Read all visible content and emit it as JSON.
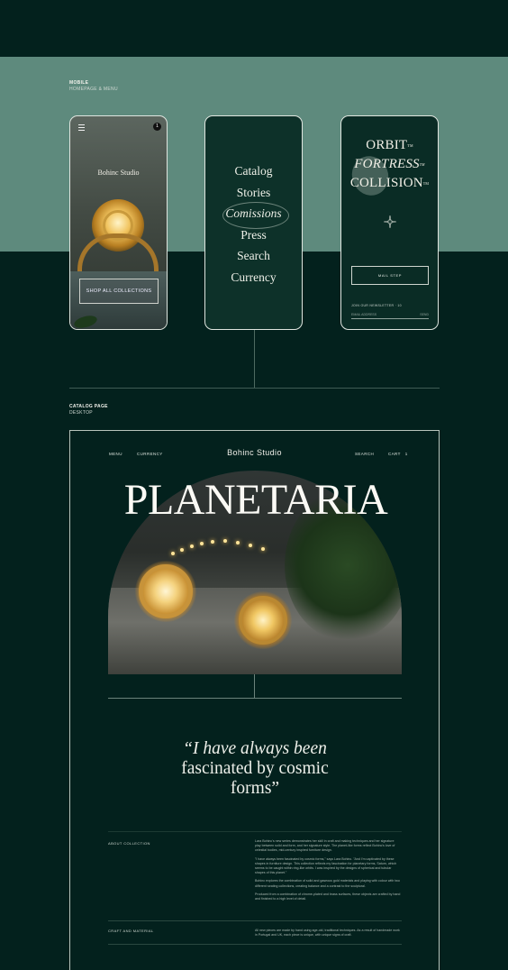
{
  "mobile_section": {
    "title": "MOBILE",
    "subtitle": "HOMEPAGE & MENU"
  },
  "phone1": {
    "cart_count": "1",
    "brand": "Bohinc Studio",
    "cta": "SHOP ALL COLLECTIONS"
  },
  "phone2": {
    "menu_items": [
      "Catalog",
      "Stories",
      "Comissions",
      "Press",
      "Search",
      "Currency"
    ]
  },
  "phone3": {
    "line1": "ORBIT",
    "line2": "FORTRESS",
    "line3": "COLLISION",
    "tm": "TM",
    "cta": "MAIL STEP",
    "newsletter_label": "JOIN OUR NEWSLETTER · 10",
    "email_placeholder": "EMAIL ADDRESS",
    "submit": "SEND"
  },
  "catalog_section": {
    "title": "CATALOG PAGE",
    "subtitle": "DESKTOP"
  },
  "desktop": {
    "nav": {
      "menu": "MENU",
      "currency": "CURRENCY",
      "brand": "Bohinc Studio",
      "search": "SEARCH",
      "cart": "CART",
      "cart_count": "1"
    },
    "headline": "PLANETARIA",
    "quote_line1": "“I have always been",
    "quote_line2": "fascinated by cosmic",
    "quote_line3": "forms”",
    "about_heading": "ABOUT COLLECTION",
    "about_paragraphs": [
      "Lara Bohinc's new series demonstrates her skill in craft and making techniques and her signature play between solid and form, and her signature style. The planet-like forms reflect Bohinc's love of celestial bodies, mid-century inspired furniture design.",
      "\"I have always been fascinated by cosmic forms,\" says Lara Bohinc. \"And I'm captivated by these shapes in furniture design. This collection reflects my fascination for planetary forms, Saturn, which seems to be caught within ring-like orbits. I was inspired by the designs of spherical and tubular shapes of this planet.\"",
      "Bohinc explores the combination of solid and gaseous gold materials and playing with colour with two different seating collections, creating balance and a contrast to the sculptural.",
      "Produced from a combination of chrome-plated and brass surfaces, these objects are crafted by hand and finished to a high level of detail."
    ],
    "craft_heading": "CRAFT AND MATERIAL",
    "craft_paragraph": "All new pieces are made by hand using age-old, traditional techniques. As a result of handmade work in Portugal and UK, each piece is unique, with unique signs of craft."
  }
}
